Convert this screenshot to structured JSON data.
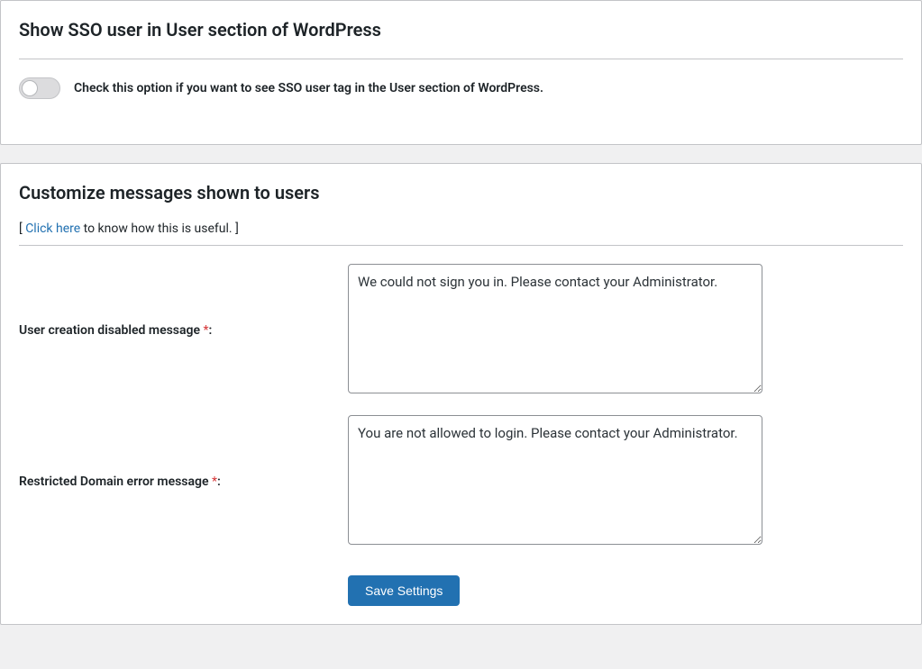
{
  "section_sso": {
    "title": "Show SSO user in User section of WordPress",
    "toggle_label": "Check this option if you want to see SSO user tag in the User section of WordPress."
  },
  "section_messages": {
    "title": "Customize messages shown to users",
    "helper_prefix": "[ ",
    "helper_link": "Click here",
    "helper_suffix": " to know how this is useful. ]",
    "fields": {
      "user_creation_disabled": {
        "label": "User creation disabled message ",
        "value": "We could not sign you in. Please contact your Administrator."
      },
      "restricted_domain": {
        "label": "Restricted Domain error message ",
        "value": "You are not allowed to login. Please contact your Administrator."
      }
    },
    "save_button": "Save Settings"
  }
}
